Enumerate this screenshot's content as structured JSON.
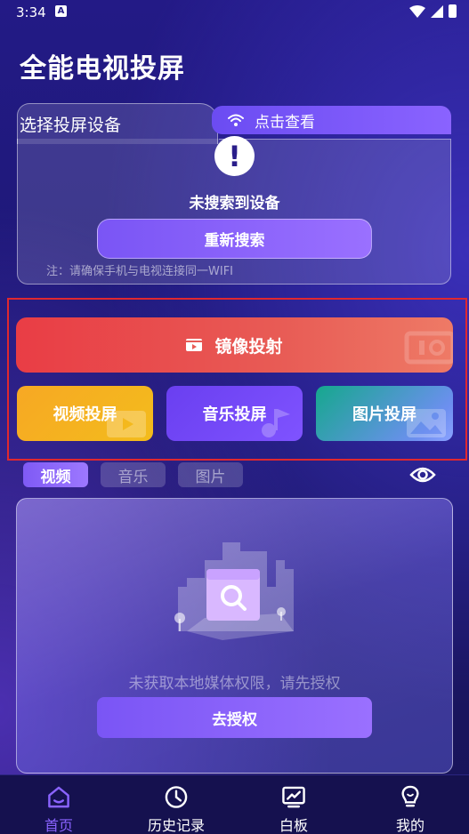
{
  "status_bar": {
    "time": "3:34",
    "indicator": "A"
  },
  "app_title": "全能电视投屏",
  "device_card": {
    "title": "选择投屏设备",
    "check_label": "点击查看",
    "alert_symbol": "!",
    "no_device_text": "未搜索到设备",
    "research_label": "重新搜索",
    "note": "注：请确保手机与电视连接同一WIFI"
  },
  "cast": {
    "mirror_label": "镜像投射",
    "video_label": "视频投屏",
    "music_label": "音乐投屏",
    "picture_label": "图片投屏"
  },
  "media_tabs": [
    {
      "label": "视频",
      "active": true
    },
    {
      "label": "音乐",
      "active": false
    },
    {
      "label": "图片",
      "active": false
    }
  ],
  "media_panel": {
    "permission_text": "未获取本地媒体权限，请先授权",
    "authorize_label": "去授权"
  },
  "bottom_nav": [
    {
      "label": "首页",
      "icon": "home-icon",
      "active": true
    },
    {
      "label": "历史记录",
      "icon": "clock-icon",
      "active": false
    },
    {
      "label": "白板",
      "icon": "whiteboard-icon",
      "active": false
    },
    {
      "label": "我的",
      "icon": "profile-icon",
      "active": false
    }
  ],
  "colors": {
    "accent": "#8a63ff",
    "mirror": "#e93d45",
    "video": "#f7a824",
    "music": "#6a3ff0",
    "picture": "#15a88d",
    "highlight": "#e0282f"
  }
}
